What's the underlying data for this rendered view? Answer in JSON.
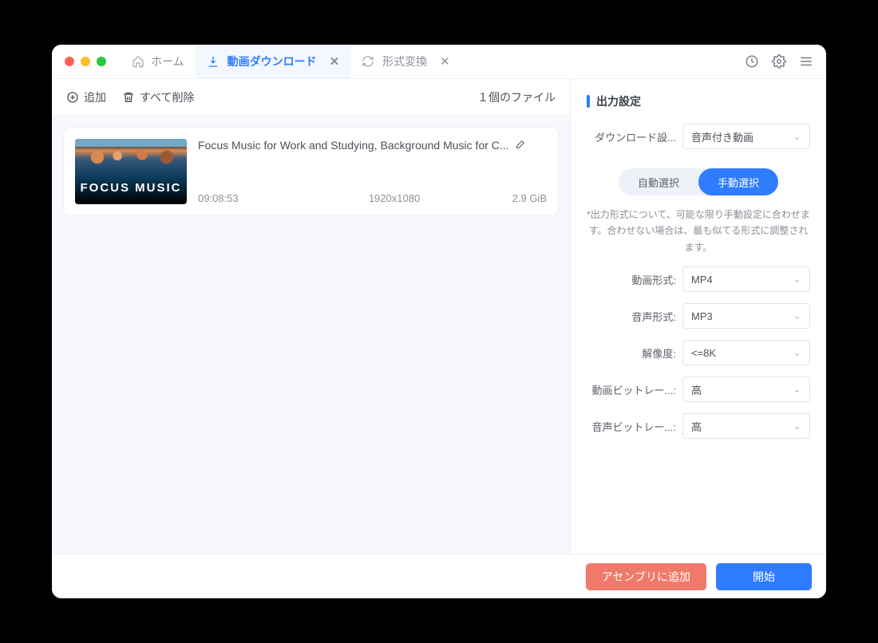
{
  "titlebar": {
    "home_label": "ホーム",
    "tabs": [
      {
        "label": "動画ダウンロード",
        "active": true
      },
      {
        "label": "形式変換",
        "active": false
      }
    ]
  },
  "toolbar": {
    "add_label": "追加",
    "delete_all_label": "すべて削除",
    "count_label": "１個のファイル"
  },
  "file": {
    "thumb_text": "FOCUS MUSIC",
    "title": "Focus Music for Work and Studying, Background Music for C...",
    "duration": "09:08:53",
    "resolution": "1920x1080",
    "size": "2.9 GiB"
  },
  "settings": {
    "title": "出力設定",
    "download_label": "ダウンロード設...",
    "download_value": "音声付き動画",
    "segment": {
      "auto": "自動選択",
      "manual": "手動選択"
    },
    "note": "*出力形式について、可能な限り手動設定に合わせます。合わせない場合は、最も似てる形式に調整されます。",
    "video_format_label": "動画形式:",
    "video_format_value": "MP4",
    "audio_format_label": "音声形式:",
    "audio_format_value": "MP3",
    "resolution_label": "解像度:",
    "resolution_value": "<=8K",
    "video_bitrate_label": "動画ビットレー...:",
    "video_bitrate_value": "高",
    "audio_bitrate_label": "音声ビットレー...:",
    "audio_bitrate_value": "高"
  },
  "footer": {
    "add_assembly": "アセンブリに追加",
    "start": "開始"
  }
}
